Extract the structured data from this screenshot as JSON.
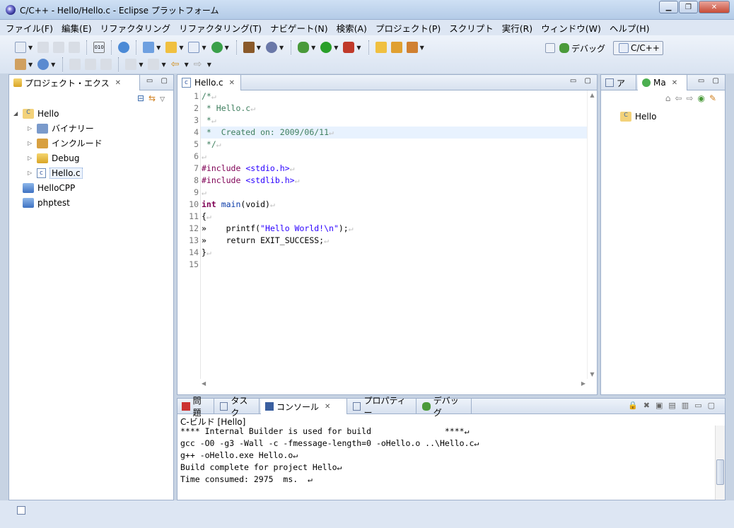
{
  "window": {
    "title": "C/C++ - Hello/Hello.c - Eclipse プラットフォーム"
  },
  "menu": [
    "ファイル(F)",
    "編集(E)",
    "リファクタリング",
    "リファクタリング(T)",
    "ナビゲート(N)",
    "検索(A)",
    "プロジェクト(P)",
    "スクリプト",
    "実行(R)",
    "ウィンドウ(W)",
    "ヘルプ(H)"
  ],
  "perspectives": {
    "debug": "デバッグ",
    "cpp": "C/C++"
  },
  "project_explorer": {
    "tab": "プロジェクト・エクス",
    "items": [
      {
        "label": "Hello"
      },
      {
        "label": "バイナリー"
      },
      {
        "label": "インクルード"
      },
      {
        "label": "Debug"
      },
      {
        "label": "Hello.c"
      },
      {
        "label": "HelloCPP"
      },
      {
        "label": "phptest"
      }
    ]
  },
  "editor": {
    "tab": "Hello.c",
    "line_numbers": [
      "1",
      "2",
      "3",
      "4",
      "5",
      "6",
      "7",
      "8",
      "9",
      "10",
      "11",
      "12",
      "13",
      "14",
      "15"
    ],
    "lines": [
      {
        "cls": "cmt",
        "text": "/*",
        "nl": "↵"
      },
      {
        "cls": "cmt",
        "text": " * Hello.c",
        "nl": "↵"
      },
      {
        "cls": "cmt",
        "text": " *",
        "nl": "↵"
      },
      {
        "cls": "cmt",
        "text": " *  Created on: 2009/06/11",
        "nl": "↵"
      },
      {
        "cls": "cmt",
        "text": " */",
        "nl": "↵"
      },
      {
        "cls": "",
        "text": "",
        "nl": "↵"
      },
      {
        "cls": "pp",
        "text": "#include ",
        "inc": "<stdio.h>",
        "nl": "↵"
      },
      {
        "cls": "pp",
        "text": "#include ",
        "inc": "<stdlib.h>",
        "nl": "↵"
      },
      {
        "cls": "",
        "text": "",
        "nl": "↵"
      },
      {
        "cls": "kw",
        "text": "int ",
        "fn": "main",
        "rest": "(void)",
        "nl": "↵"
      },
      {
        "cls": "",
        "text": "{",
        "nl": "↵"
      },
      {
        "cls": "",
        "text": "»    printf(",
        "str": "\"Hello World!\\n\"",
        "rest": ");",
        "nl": "↵"
      },
      {
        "cls": "",
        "text": "»    return EXIT_SUCCESS;",
        "nl": "↵"
      },
      {
        "cls": "",
        "text": "}",
        "nl": "↵"
      },
      {
        "cls": "",
        "text": "",
        "nl": ""
      }
    ]
  },
  "right_panel": {
    "tab1": "ア",
    "tab2": "Ma",
    "item": "Hello"
  },
  "bottom_tabs": {
    "problems": "問題",
    "tasks": "タスク",
    "console": "コンソール",
    "properties": "プロパティー",
    "debug": "デバッグ"
  },
  "console": {
    "title": "C-ビルド [Hello]",
    "lines": [
      "**** Internal Builder is used for build               ****↵",
      "gcc -O0 -g3 -Wall -c -fmessage-length=0 -oHello.o ..\\Hello.c↵",
      "g++ -oHello.exe Hello.o↵",
      "Build complete for project Hello↵",
      "Time consumed: 2975  ms.  ↵"
    ]
  }
}
